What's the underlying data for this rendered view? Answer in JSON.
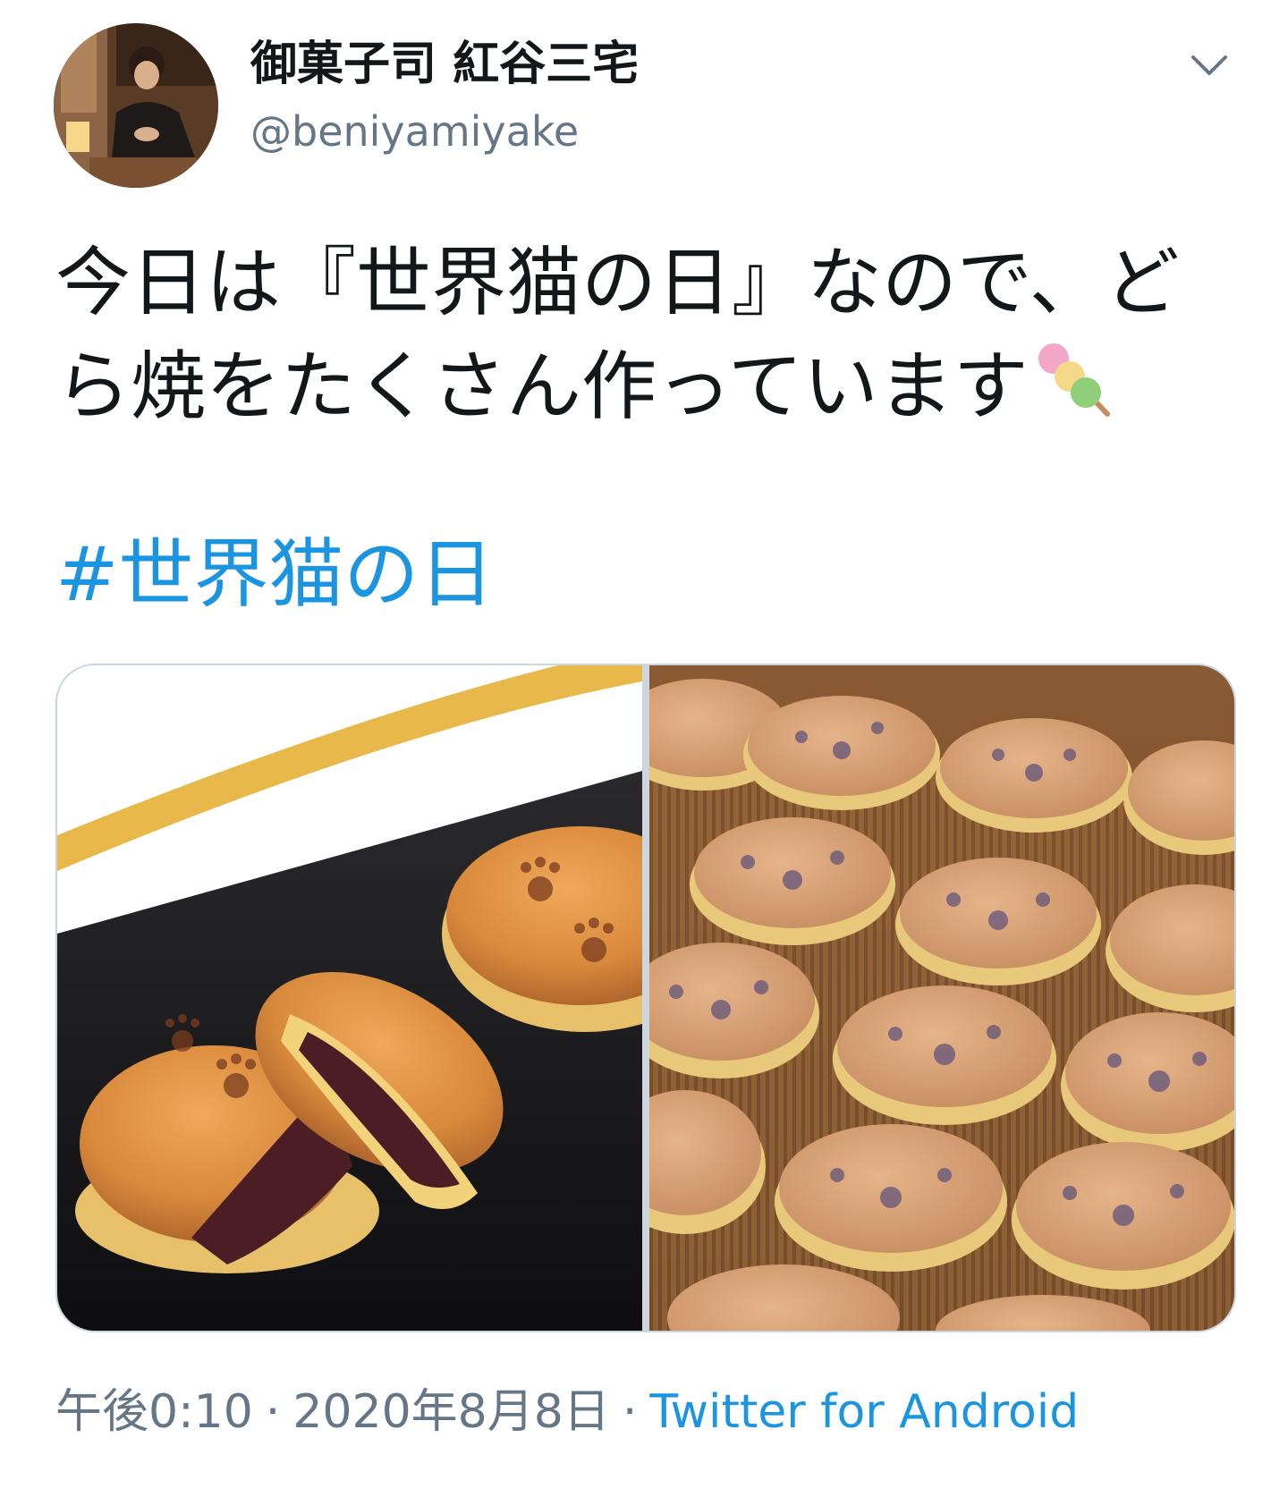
{
  "author": {
    "display_name": "御菓子司 紅谷三宅",
    "handle": "@beniyamiyake",
    "avatar_icon": "avatar-photo"
  },
  "menu": {
    "icon": "chevron-down-icon"
  },
  "tweet": {
    "line1": "今日は『世界猫の日』なので、ど",
    "line2": "ら焼をたくさん作っています",
    "emoji": "dango-emoji",
    "hashtag": "#世界猫の日"
  },
  "media": {
    "photos": [
      "dorayaki-closeup-photo",
      "dorayaki-rows-photo"
    ]
  },
  "footer": {
    "time": "午後0:10",
    "separator": "·",
    "date": "2020年8月8日",
    "source": "Twitter for Android"
  },
  "colors": {
    "text": "#14171a",
    "secondary": "#657786",
    "link": "#1b95e0",
    "border": "#ccd6dd"
  }
}
